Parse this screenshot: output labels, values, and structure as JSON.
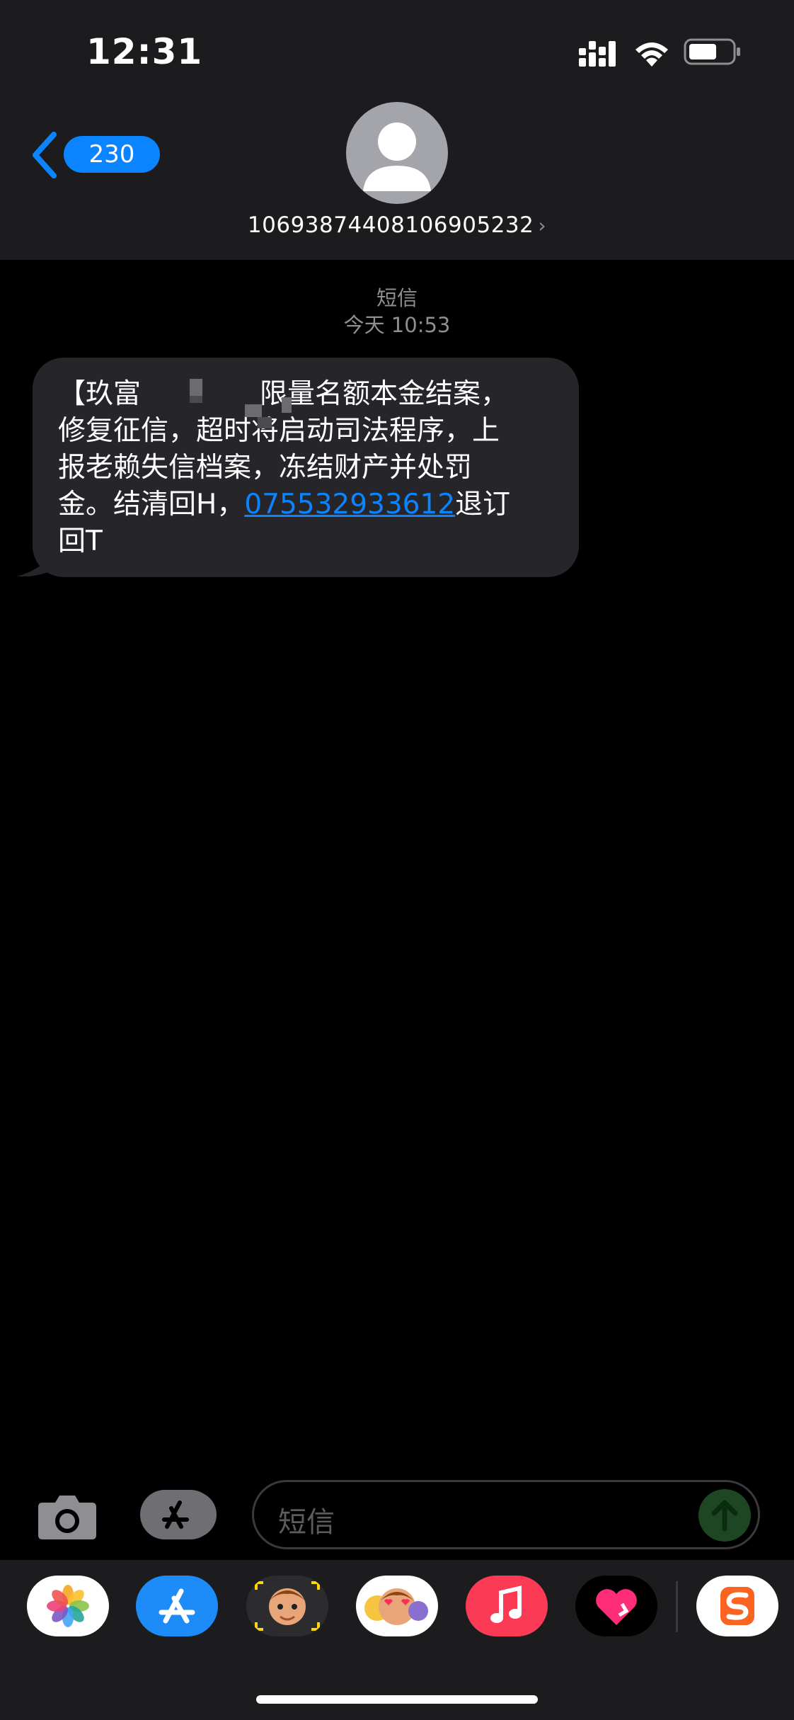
{
  "status_bar": {
    "time": "12:31"
  },
  "header": {
    "back_count": "230",
    "contact_number": "10693874408106905232"
  },
  "thread": {
    "service_label": "短信",
    "timestamp": "今天 10:53"
  },
  "message": {
    "line1": "【玖富",
    "line1_rest": "限量名额本金结案，",
    "line2a": "修复征信，",
    "line2b": "超时将启动司法程序，上",
    "line3": "报老赖失信档案，冻结财产并处罚",
    "line4_pre": "金。结清回H，",
    "phone": "075532933612",
    "line4_post": "退订",
    "line5": "回T"
  },
  "composer": {
    "placeholder": "短信"
  },
  "app_drawer": {
    "apps": [
      "photos-app",
      "app-store-app",
      "memoji-stickers-app",
      "animoji-app",
      "music-app",
      "health-heart-app",
      "sogou-input-app"
    ]
  },
  "colors": {
    "accent": "#0a84ff",
    "bubble": "#26252a",
    "header": "#1c1c1e"
  }
}
